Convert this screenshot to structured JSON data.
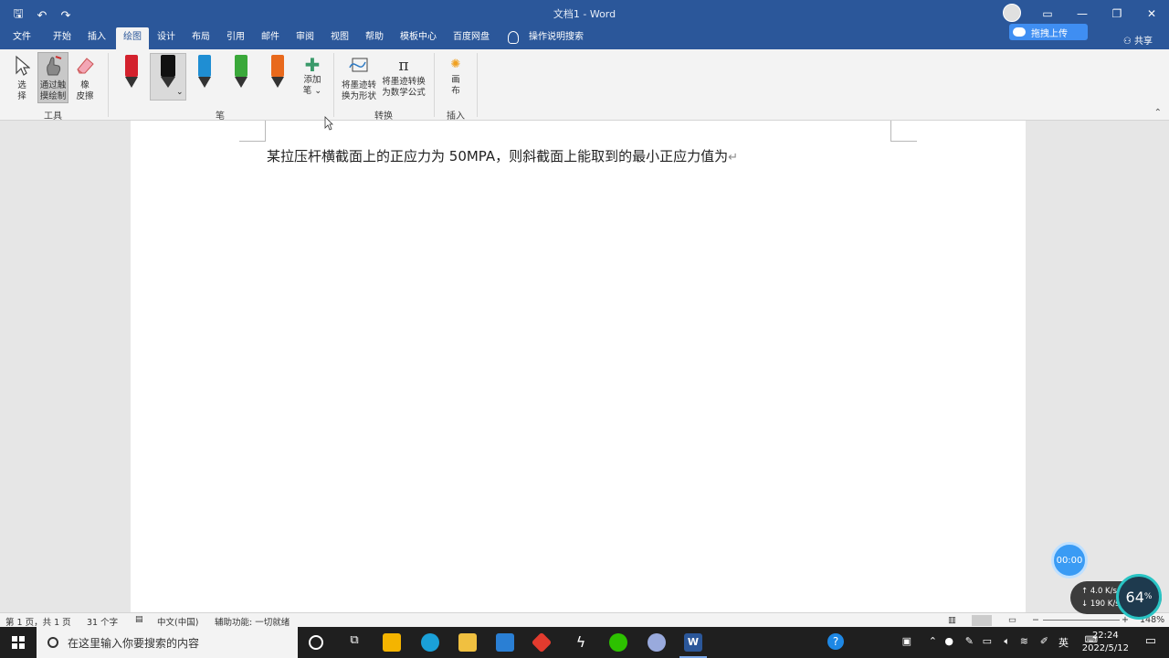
{
  "titlebar": {
    "title": "文档1 - Word",
    "qat": [
      "🖫",
      "↶",
      "↷"
    ],
    "baidu_upload": "拖拽上传"
  },
  "tabs": [
    "文件",
    "开始",
    "插入",
    "绘图",
    "设计",
    "布局",
    "引用",
    "邮件",
    "审阅",
    "视图",
    "帮助",
    "模板中心",
    "百度网盘",
    "操作说明搜索"
  ],
  "share_label": "共享",
  "ribbon": {
    "tools": {
      "select": [
        "选",
        "择"
      ],
      "touch_draw": [
        "通过触",
        "摸绘制"
      ],
      "eraser": [
        "橡",
        "皮擦"
      ],
      "group": "工具"
    },
    "pens": {
      "add": [
        "添加",
        "笔 ⌄"
      ],
      "group": "笔",
      "colors": [
        "#d3212d",
        "#111111",
        "#1f8ed3",
        "#3aa83a",
        "#e8691c"
      ]
    },
    "convert": {
      "to_shape": [
        "将墨迹转",
        "换为形状"
      ],
      "to_math": [
        "将墨迹转换",
        "为数学公式"
      ],
      "group": "转换"
    },
    "insert": {
      "canvas": [
        "画",
        "布"
      ],
      "group": "插入"
    }
  },
  "document": {
    "text": "某拉压杆横截面上的正应力为 50MPA，则斜截面上能取到的最小正应力值为",
    "pilcrow": "↵"
  },
  "statusbar": {
    "page": "第 1 页，共 1 页",
    "words": "31 个字",
    "lang": "中文(中国)",
    "accessibility": "辅助功能: 一切就绪",
    "zoom": "148%"
  },
  "overlays": {
    "timer": "00:00",
    "upload_speed": "4.0 K/s",
    "download_speed": "190 K/s",
    "gauge_value": "64",
    "gauge_unit": "%"
  },
  "taskbar": {
    "search_placeholder": "在这里输入你要搜索的内容",
    "ime": "英",
    "time": "22:24",
    "date": "2022/5/12"
  }
}
